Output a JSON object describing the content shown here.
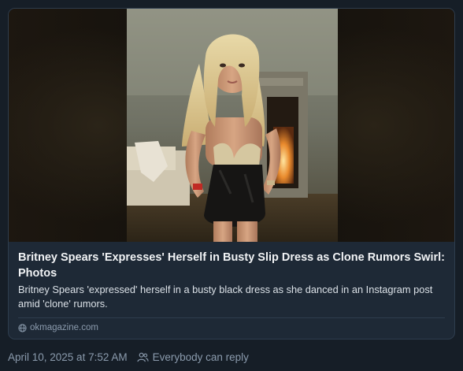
{
  "link_card": {
    "title": "Britney Spears 'Expresses' Herself in Busty Slip Dress as Clone Rumors Swirl: Photos",
    "description": "Britney Spears 'expressed' herself in a busty black dress as she danced in an Instagram post amid 'clone' rumors.",
    "domain": "okmagazine.com",
    "domain_icon": "globe-icon"
  },
  "post_meta": {
    "timestamp": "April 10, 2025 at 7:52 AM",
    "reply_setting": "Everybody can reply",
    "reply_icon": "people-icon"
  }
}
